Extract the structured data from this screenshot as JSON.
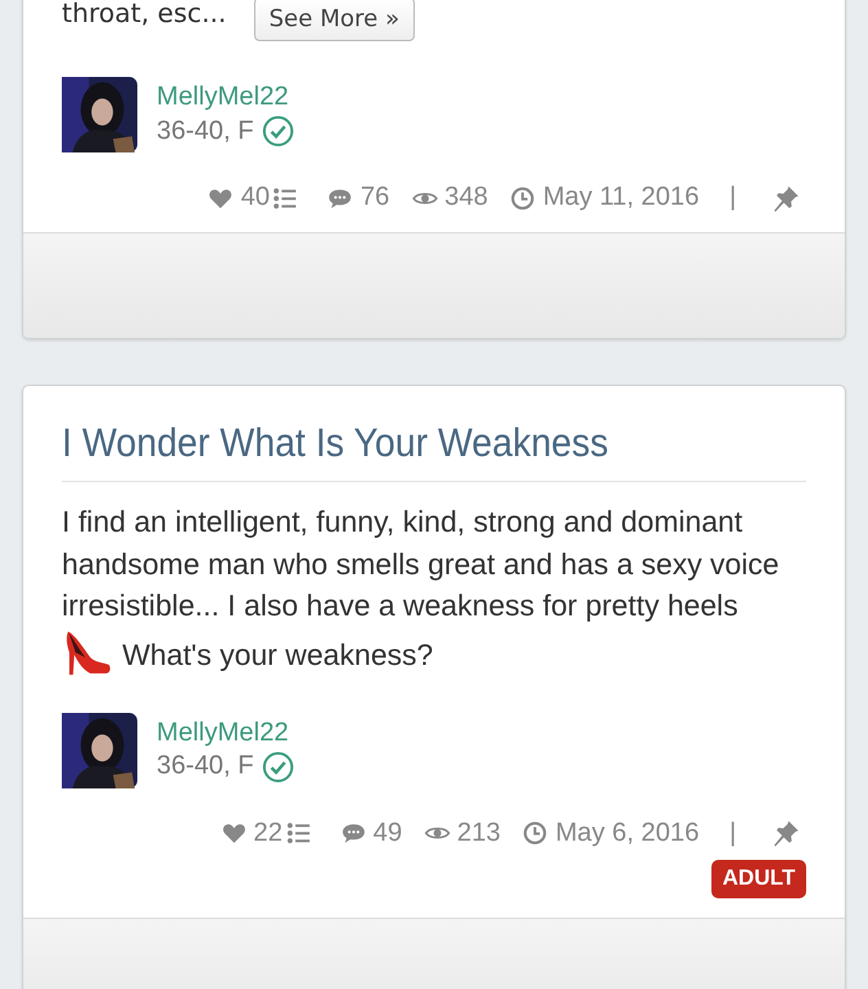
{
  "posts": [
    {
      "excerpt": "throat, esc...",
      "see_more": "See More »",
      "author": {
        "name": "MellyMel22",
        "info": "36-40, F",
        "verified": true
      },
      "stats": {
        "likes": "40",
        "comments": "76",
        "views": "348",
        "date": "May 11, 2016",
        "separator": "|"
      }
    },
    {
      "title": "I Wonder What Is Your Weakness",
      "description": [
        {
          "kind": "text",
          "text": "I find an intelligent, funny, kind, strong and dominant handsome man who smells great and has a sexy voice irresistible... I also have a weakness for pretty heels"
        },
        {
          "kind": "heel"
        },
        {
          "kind": "text",
          "text": "What's your weakness?"
        }
      ],
      "author": {
        "name": "MellyMel22",
        "info": "36-40, F",
        "verified": true
      },
      "stats": {
        "likes": "22",
        "comments": "49",
        "views": "213",
        "date": "May 6, 2016",
        "separator": "|"
      },
      "badge": "ADULT"
    }
  ]
}
